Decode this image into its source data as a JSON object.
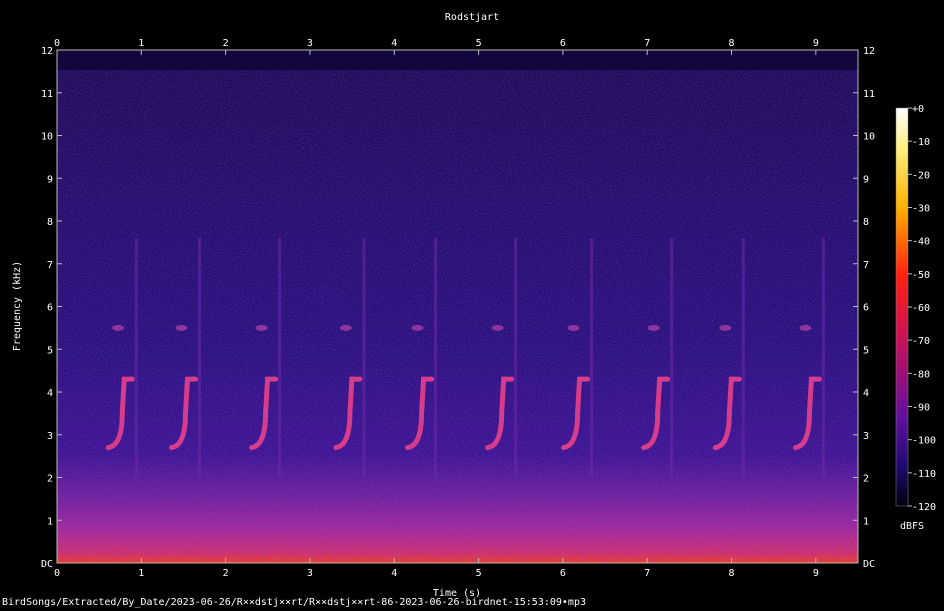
{
  "chart_data": {
    "type": "heatmap",
    "title": "Rodstjart",
    "xlabel": "Time (s)",
    "ylabel": "Frequency (kHz)",
    "x_ticks": [
      "0",
      "1",
      "2",
      "3",
      "4",
      "5",
      "6",
      "7",
      "8",
      "9"
    ],
    "y_ticks": [
      "DC",
      "1",
      "2",
      "3",
      "4",
      "5",
      "6",
      "7",
      "8",
      "9",
      "10",
      "11",
      "12"
    ],
    "xlim": [
      0,
      9.5
    ],
    "ylim": [
      0,
      12
    ],
    "colorbar": {
      "label": "dBFS",
      "ticks": [
        "+0",
        "-10",
        "-20",
        "-30",
        "-40",
        "-50",
        "-60",
        "-70",
        "-80",
        "-90",
        "-100",
        "-110",
        "-120"
      ],
      "range": [
        -120,
        0
      ]
    },
    "song_times_s": [
      0.75,
      1.5,
      2.45,
      3.45,
      4.3,
      5.25,
      6.15,
      7.1,
      7.95,
      8.9
    ],
    "song_freq_khz": [
      2.7,
      4.3
    ],
    "noise_floor_khz": 1.2
  },
  "footer": {
    "path": "BirdSongs/Extracted/By_Date/2023-06-26/R××dstj××rt/R××dstj××rt-86-2023-06-26-birdnet-15:53:09•mp3"
  }
}
